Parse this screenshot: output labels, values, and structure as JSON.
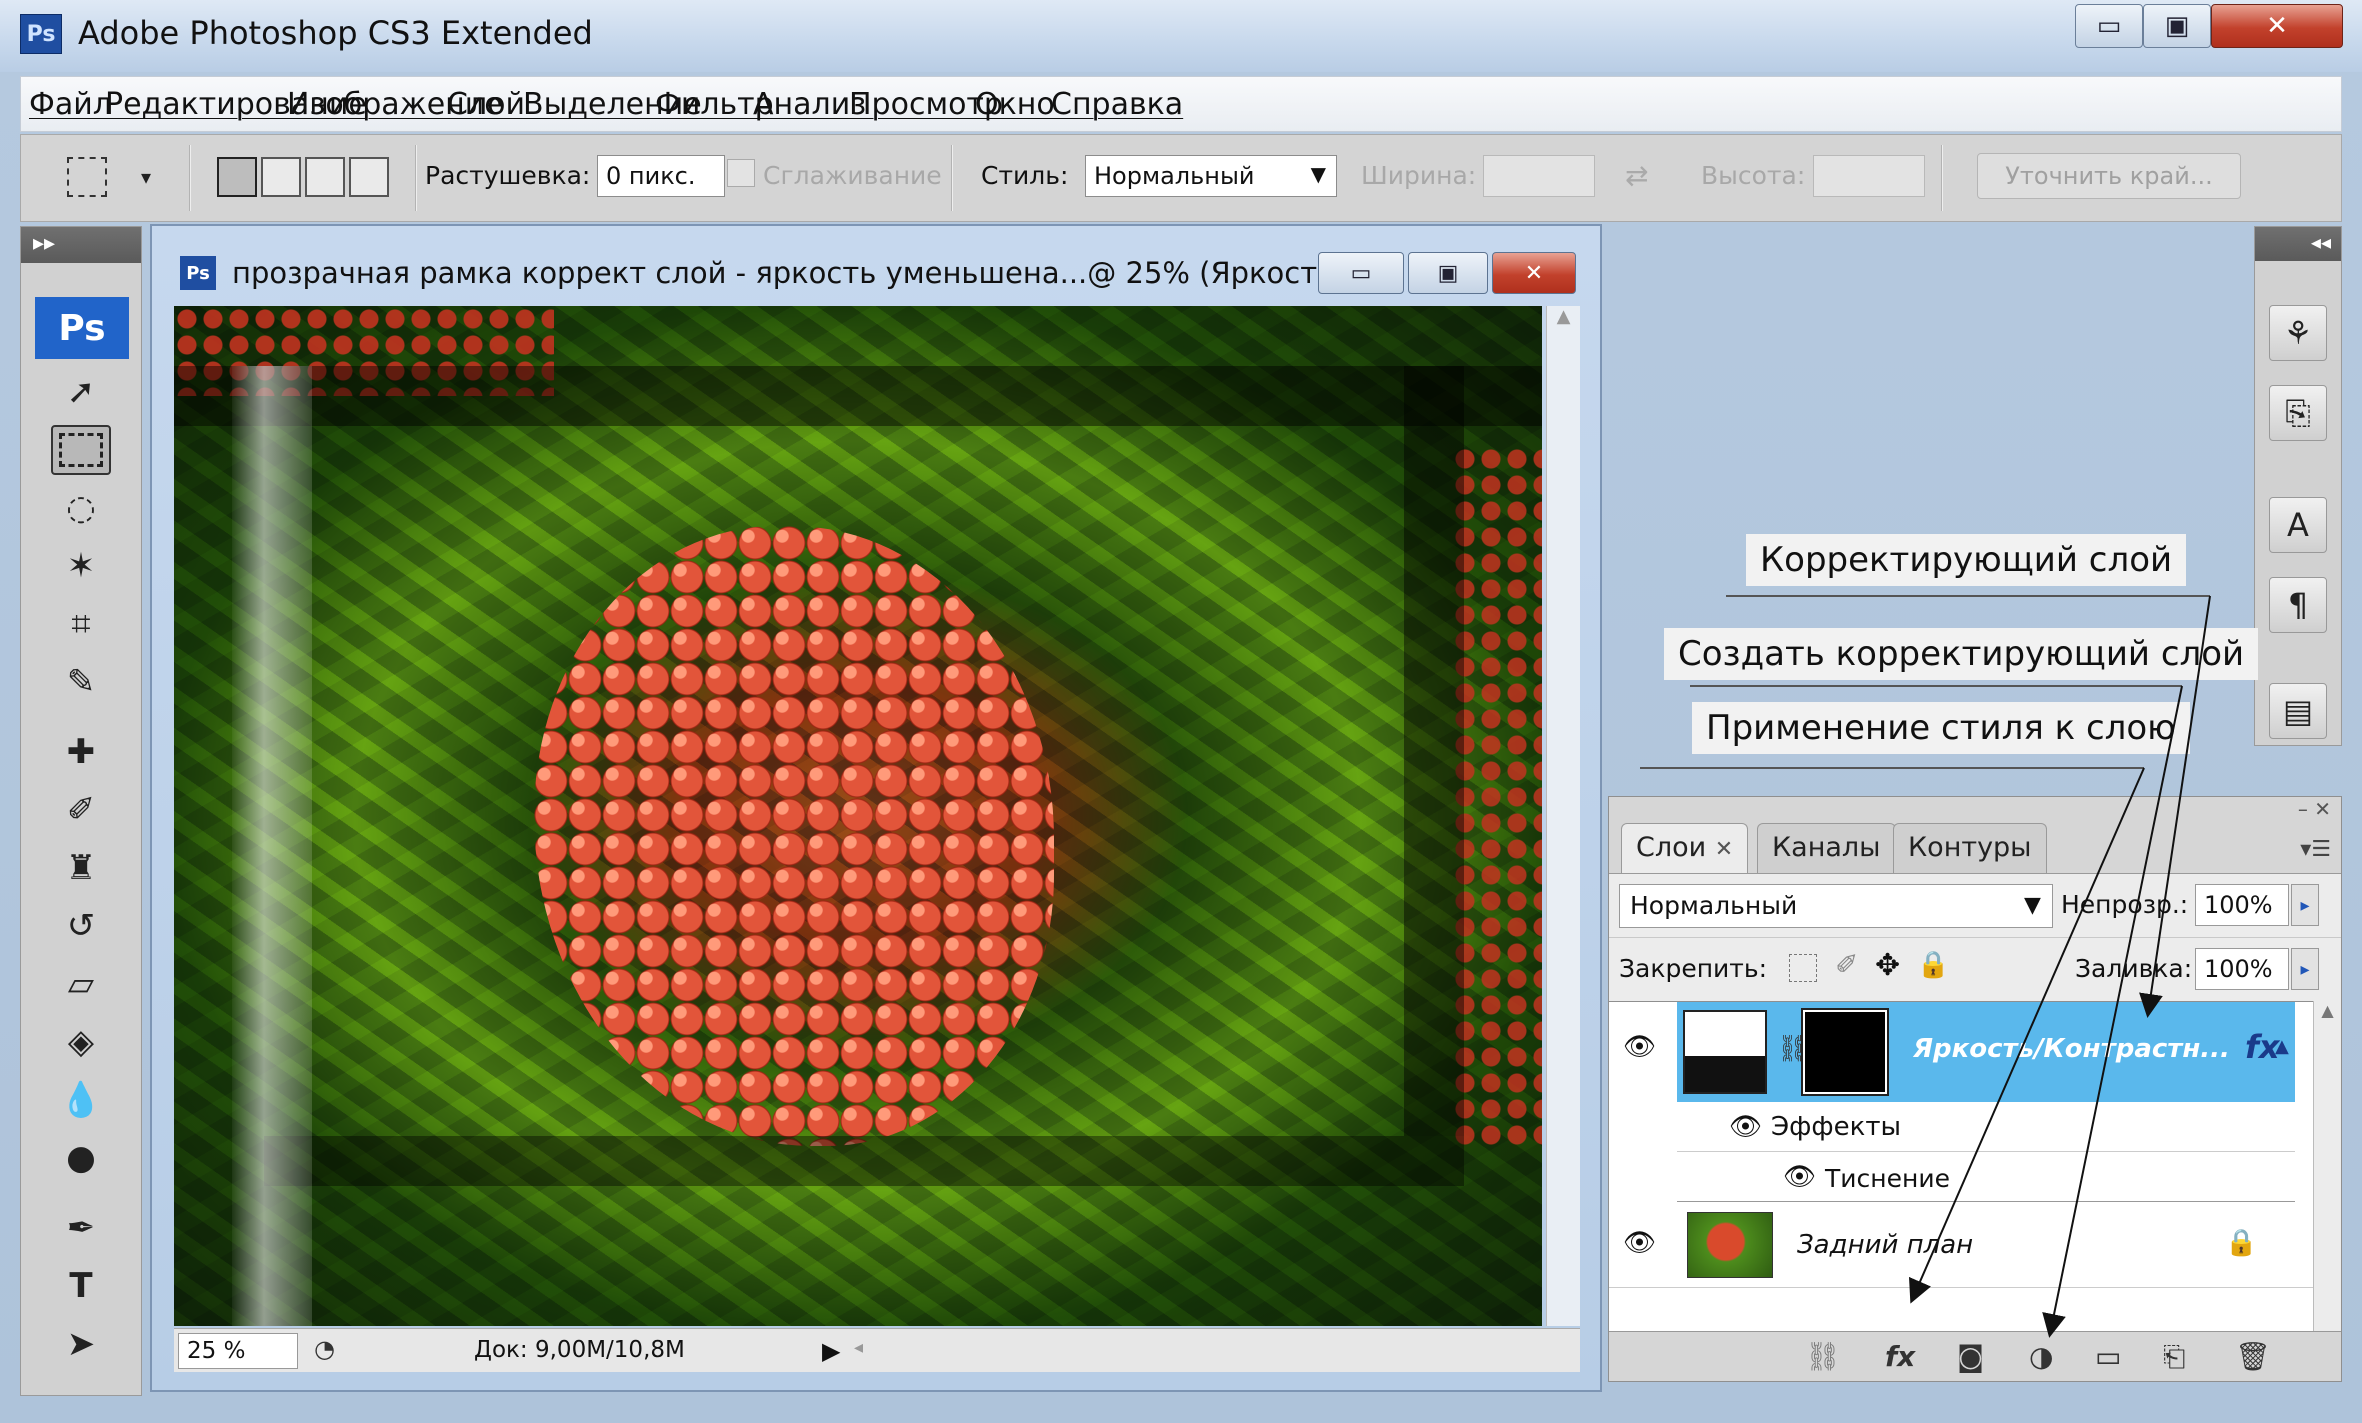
{
  "window": {
    "app_icon": "Ps",
    "title": "Adobe Photoshop CS3 Extended",
    "min_symbol": "▭",
    "max_symbol": "▣",
    "close_symbol": "✕"
  },
  "menu": [
    "Файл",
    "Редактирование",
    "Изображение",
    "Слой",
    "Выделение",
    "Фильтр",
    "Анализ",
    "Просмотр",
    "Окно",
    "Справка"
  ],
  "options": {
    "feather_label": "Растушевка:",
    "feather_value": "0 пикс.",
    "antialias_label": "Сглаживание",
    "style_label": "Стиль:",
    "style_value": "Нормальный",
    "width_label": "Ширина:",
    "height_label": "Высота:",
    "refine_edge": "Уточнить край..."
  },
  "toolbox": {
    "logo": "Ps",
    "collapse": "▸▸"
  },
  "document": {
    "icon": "Ps",
    "title": "прозрачная рамка коррект слой - яркость уменьшена...@ 25% (Яркост...",
    "zoom": "25 %",
    "doc_info": "Док: 9,00M/10,8M"
  },
  "callouts": {
    "adjustment_layer": "Корректирующий слой",
    "create_adjustment_layer": "Создать корректирующий слой",
    "apply_layer_style": "Применение стиля к слою"
  },
  "layers_panel": {
    "tabs": [
      "Слои",
      "Каналы",
      "Контуры"
    ],
    "blend_mode": "Нормальный",
    "opacity_label": "Непрозр.:",
    "opacity_value": "100%",
    "lock_label": "Закрепить:",
    "fill_label": "Заливка:",
    "fill_value": "100%",
    "adjustment_layer_name": "Яркость/Контрастн...",
    "fx_badge": "fx",
    "effects_label": "Эффекты",
    "emboss_label": "Тиснение",
    "background_layer_name": "Задний план"
  },
  "colors": {
    "selected_layer": "#5ab8ec",
    "close_button": "#c2412c",
    "ps_blue": "#2164c9"
  }
}
